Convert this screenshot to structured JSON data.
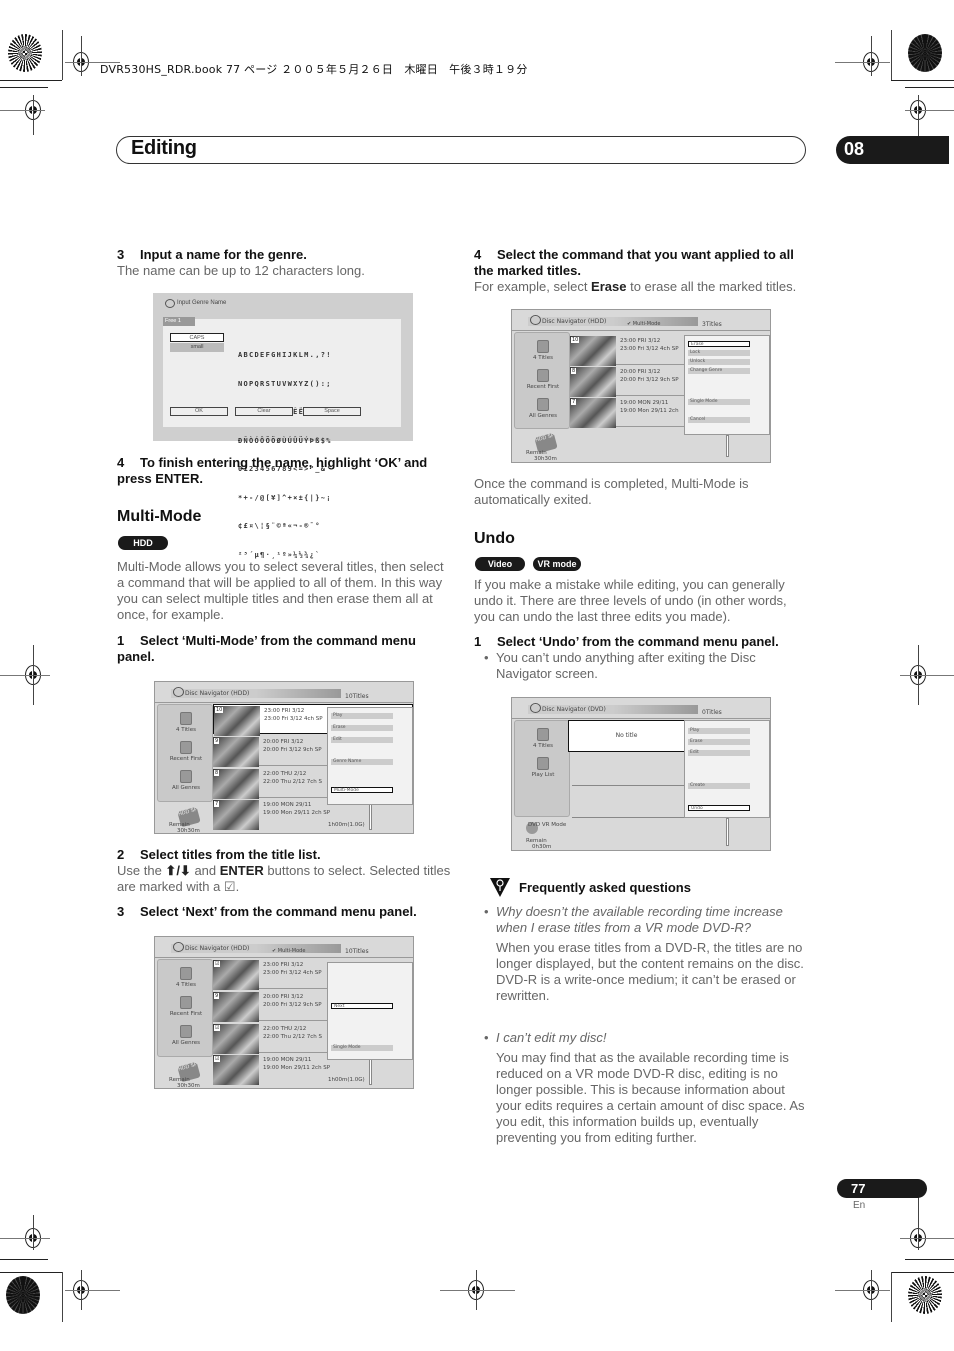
{
  "print_header": "DVR530HS_RDR.book  77 ページ  ２００５年５月２６日　木曜日　午後３時１９分",
  "chapter": {
    "title": "Editing",
    "number": "08"
  },
  "left_column": {
    "step3": {
      "num": "3",
      "title": "Input a name for the genre.",
      "body": "The name can be up to 12 characters long."
    },
    "genre_screen": {
      "title": "Input Genre Name",
      "field_value": "Free 1",
      "modes": [
        "CAPS",
        "small"
      ],
      "charset_rows": [
        "ABCDEFGHIJKLM.,?!",
        "NOPQRSTUVWXYZ():;",
        "ÀÁÂÃÄÅÆÇÈÉÊËÌÍÎÏ#",
        "ÐÑÒÓÔÕÖØÙÚÛÜÝÞß$%",
        "0123456789<=>\"_&'",
        "*+-/@[¥]^+×±{|}~¡",
        "¢£¤\\¦§¨©ª«¬-®¯°",
        "²³´µ¶·¸¹º»¼½¾¿`"
      ],
      "buttons": [
        "OK",
        "Clear",
        "Space"
      ]
    },
    "step4": {
      "num": "4",
      "title": "To finish entering the name, highlight ‘OK’ and press ENTER."
    },
    "multimode": {
      "heading": "Multi-Mode",
      "badge": "HDD",
      "intro": "Multi-Mode allows you to select several titles, then select a command that will be applied to all of them. In this way you can select multiple titles and then erase them all at once, for example.",
      "step1": {
        "num": "1",
        "title": "Select ‘Multi-Mode’ from the command menu panel."
      },
      "step2": {
        "num": "2",
        "title": "Select titles from the title list.",
        "body_pre": "Use the ",
        "arrows": "⬆/⬇",
        "body_mid": " and ",
        "enter": "ENTER",
        "body_post": " buttons to select. Selected titles are marked with a ☑."
      },
      "step3": {
        "num": "3",
        "title": "Select ‘Next’ from the command menu panel."
      }
    }
  },
  "screens": {
    "nav1": {
      "title": "Disc Navigator (HDD)",
      "count": "10Titles",
      "sidebar": [
        "4 Titles",
        "Recent First",
        "All Genres"
      ],
      "badge": "HDD SP",
      "remain": "Remain",
      "remain_time": "30h30m",
      "rows": [
        {
          "num": "10",
          "line1": "23:00 FRI  3/12",
          "line2": "23:00 Fri  3/12  4ch  SP"
        },
        {
          "num": "9",
          "line1": "20:00 FRI  3/12",
          "line2": "20:00 Fri  3/12  9ch  SP"
        },
        {
          "num": "8",
          "line1": "22:00 THU  2/12",
          "line2": "22:00 Thu  2/12  7ch  S"
        },
        {
          "num": "7",
          "line1": "19:00 MON  29/11",
          "line2": "19:00 Mon  29/11  2ch  SP"
        }
      ],
      "size": "1h00m(1.0G)",
      "menu": [
        "Play",
        "Erase",
        "Edit",
        "Genre Name",
        "Multi-Mode"
      ]
    },
    "nav2": {
      "title": "Disc Navigator (HDD)",
      "mode": "Multi-Mode",
      "count": "10Titles",
      "sidebar": [
        "4 Titles",
        "Recent First",
        "All Genres"
      ],
      "badge": "HDD SP",
      "remain": "Remain",
      "remain_time": "30h30m",
      "rows": [
        {
          "num": "☑",
          "line1": "23:00 FRI  3/12",
          "line2": "23:00 Fri  3/12  4ch  SP"
        },
        {
          "num": "9",
          "line1": "20:00 FRI  3/12",
          "line2": "20:00 Fri  3/12  9ch  SP"
        },
        {
          "num": "☑",
          "line1": "22:00 THU  2/12",
          "line2": "22:00 Thu  2/12  7ch  S"
        },
        {
          "num": "☑",
          "line1": "19:00 MON  29/11",
          "line2": "19:00 Mon  29/11  2ch  SP"
        }
      ],
      "size": "1h00m(1.0G)",
      "menu": [
        "Next",
        "Single Mode"
      ]
    },
    "nav3": {
      "title": "Disc Navigator (HDD)",
      "mode": "Multi-Mode",
      "count": "3Titles",
      "sidebar": [
        "4 Titles",
        "Recent First",
        "All Genres"
      ],
      "badge": "HDD SP",
      "remain": "Remain",
      "remain_time": "30h30m",
      "rows": [
        {
          "num": "10",
          "line1": "23:00 FRI  3/12",
          "line2": "23:00 Fri  3/12  4ch  SP"
        },
        {
          "num": "8",
          "line1": "20:00 FRI  3/12",
          "line2": "20:00 Fri  3/12  9ch  SP"
        },
        {
          "num": "7",
          "line1": "19:00 MON  29/11",
          "line2": "19:00 Mon  29/11  2ch"
        }
      ],
      "menu": [
        "Erase",
        "Lock",
        "Unlock",
        "Change Genre",
        "Single Mode",
        "Cancel"
      ]
    },
    "nav4": {
      "title": "Disc Navigator (DVD)",
      "count": "0Titles",
      "sidebar": [
        "4 Titles",
        "Play List"
      ],
      "badge": "DVD VR Mode",
      "remain": "Remain",
      "remain_time": "0h30m",
      "no_title": "No title",
      "menu": [
        "Play",
        "Erase",
        "Edit",
        "Create",
        "Undo"
      ]
    }
  },
  "right_column": {
    "step4": {
      "num": "4",
      "title": "Select the command that you want applied to all the marked titles.",
      "body_pre": "For example, select ",
      "bold": "Erase",
      "body_post": " to erase all the marked titles."
    },
    "after_note": "Once the command is completed, Multi-Mode is automatically exited.",
    "undo": {
      "heading": "Undo",
      "badges": [
        "Video mode",
        "VR mode"
      ],
      "intro": "If you make a mistake while editing, you can generally undo it. There are three levels of undo (in other words, you can undo the last three edits you made).",
      "step1": {
        "num": "1",
        "title": "Select ‘Undo’ from the command menu panel."
      },
      "bullet": "You can’t undo anything after exiting the Disc Navigator screen."
    },
    "faq": {
      "title": "Frequently asked questions",
      "items": [
        {
          "q": "Why doesn’t the available recording time increase when I erase titles from a VR mode DVD-R?",
          "a": "When you erase titles from a DVD-R, the titles are no longer displayed, but the content remains on the disc. DVD-R is a write-once medium; it can’t be erased or rewritten."
        },
        {
          "q": "I can’t edit my disc!",
          "a": "You may find that as the available recording time is reduced on a VR mode DVD-R disc, editing is no longer possible. This is because information about your edits requires a certain amount of disc space. As you edit, this information builds up, eventually preventing you from editing further."
        }
      ]
    }
  },
  "footer": {
    "page": "77",
    "lang": "En"
  }
}
